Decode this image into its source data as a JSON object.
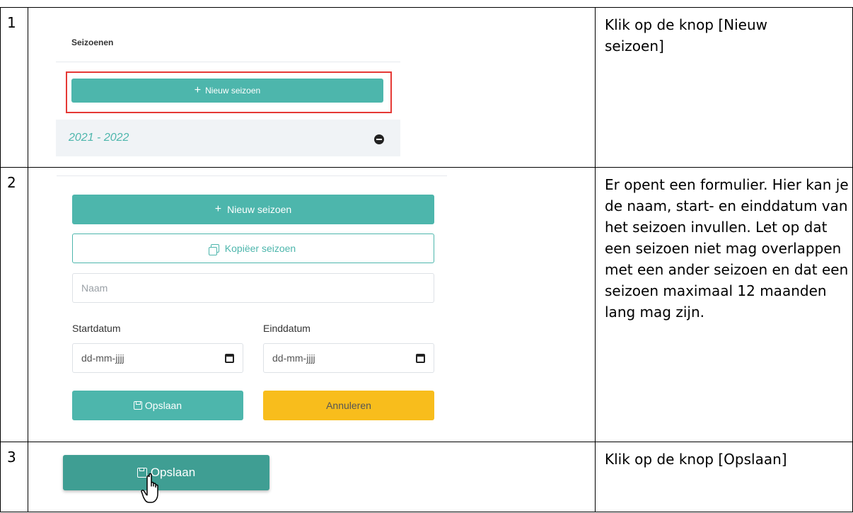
{
  "rows": [
    {
      "number": "1",
      "instruction": "Klik op de knop [Nieuw seizoen]"
    },
    {
      "number": "2",
      "instruction": "Er opent een formulier. Hier kan je de naam, start- en einddatum van het seizoen invullen. Let op dat een seizoen niet mag overlappen met een ander seizoen en dat een seizoen maximaal 12 maanden lang mag zijn."
    },
    {
      "number": "3",
      "instruction": "Klik op de knop [Opslaan]"
    }
  ],
  "panel1": {
    "title": "Seizoenen",
    "new_season_label": "Nieuw seizoen",
    "season_item": "2021 - 2022"
  },
  "form": {
    "new_season_label": "Nieuw seizoen",
    "copy_season_label": "Kopiëer seizoen",
    "name_placeholder": "Naam",
    "start_label": "Startdatum",
    "end_label": "Einddatum",
    "date_placeholder": "dd-mm-jjjj",
    "save_label": "Opslaan",
    "cancel_label": "Annuleren"
  },
  "step3": {
    "save_label": "Opslaan"
  },
  "colors": {
    "teal": "#4db6ac",
    "teal_dark": "#3f9e93",
    "yellow": "#f8bd1c",
    "highlight_red": "#e53935"
  }
}
